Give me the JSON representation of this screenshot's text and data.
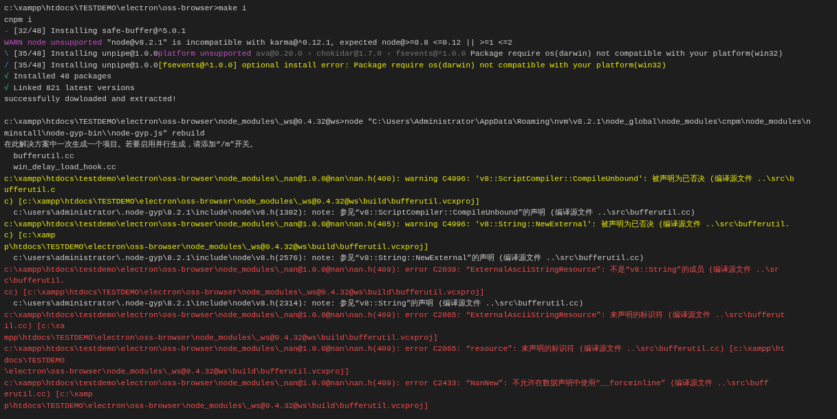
{
  "terminal": {
    "lines": [
      {
        "kind": "text",
        "segments": [
          {
            "kind": "plain",
            "text": "c:\\xampp\\htdocs\\TESTDEMO\\electron\\oss-browser>make i"
          }
        ]
      },
      {
        "kind": "text",
        "segments": [
          {
            "kind": "plain",
            "text": "cnpm i"
          }
        ]
      },
      {
        "kind": "text",
        "segments": [
          {
            "kind": "blue",
            "text": "- "
          },
          {
            "kind": "plain",
            "text": "[32/48] Installing safe-buffer@^5.0.1"
          }
        ]
      },
      {
        "kind": "text",
        "segments": [
          {
            "kind": "magenta",
            "text": "WARN node unsupported"
          },
          {
            "kind": "plain",
            "text": " \"node@v8.2.1\" is incompatible with karma@^0.12.1, expected node@>=0.8 <=0.12 || >=1 <=2"
          }
        ]
      },
      {
        "kind": "text",
        "segments": [
          {
            "kind": "blue",
            "text": "\\ "
          },
          {
            "kind": "plain",
            "text": "[35/48] Installing unpipe@1.0.0"
          },
          {
            "kind": "magenta",
            "text": "platform unsupported"
          },
          {
            "kind": "gray",
            "text": " ava@0.20.0 › chokidar@1.7.0 › fsevents@^1.0.0"
          },
          {
            "kind": "plain",
            "text": " Package require os(darwin) not compatible with your platform(win32)"
          }
        ]
      },
      {
        "kind": "text",
        "segments": [
          {
            "kind": "blue",
            "text": "/ "
          },
          {
            "kind": "plain",
            "text": "[35/48] Installing unpipe@1.0.0"
          },
          {
            "kind": "yellow",
            "text": "[fsevents@^1.0.0] optional install error: Package require os(darwin) not compatible with your platform(win32)"
          }
        ]
      },
      {
        "kind": "text",
        "segments": [
          {
            "kind": "green",
            "text": "√"
          },
          {
            "kind": "plain",
            "text": " Installed 48 packages"
          }
        ]
      },
      {
        "kind": "text",
        "segments": [
          {
            "kind": "green",
            "text": "√"
          },
          {
            "kind": "plain",
            "text": " Linked 821 latest versions"
          }
        ]
      },
      {
        "kind": "text",
        "segments": [
          {
            "kind": "plain",
            "text": "successfully dowloaded and extracted!"
          }
        ]
      },
      {
        "kind": "blank"
      },
      {
        "kind": "text",
        "segments": [
          {
            "kind": "plain",
            "text": "c:\\xampp\\htdocs\\TESTDEMO\\electron\\oss-browser\\node_modules\\_ws@0.4.32@ws>node \"C:\\Users\\Administrator\\AppData\\Roaming\\nvm\\v8.2.1\\node_global\\node_modules\\cnpm\\node_modules\\n"
          }
        ]
      },
      {
        "kind": "text",
        "segments": [
          {
            "kind": "plain",
            "text": "minstall\\node-gyp-bin\\\\node-gyp.js\" rebuild"
          }
        ]
      },
      {
        "kind": "text",
        "segments": [
          {
            "kind": "plain",
            "text": "在此解决方案中一次生成一个项目。若要启用并行生成，请添加“/m”开关。"
          }
        ]
      },
      {
        "kind": "text",
        "segments": [
          {
            "kind": "plain",
            "text": "  bufferutil.cc"
          }
        ]
      },
      {
        "kind": "text",
        "segments": [
          {
            "kind": "plain",
            "text": "  win_delay_load_hook.cc"
          }
        ]
      },
      {
        "kind": "text",
        "segments": [
          {
            "kind": "yellow",
            "text": "c:\\xampp\\htdocs\\testdemo\\electron\\oss-browser\\node_modules\\_nan@1.0.0@nan\\nan.h(400): warning C4996: 'v8::ScriptCompiler::CompileUnbound': 被声明为已否决 (编译源文件 ..\\src\\b"
          }
        ]
      },
      {
        "kind": "text",
        "segments": [
          {
            "kind": "yellow",
            "text": "ufferutil.c"
          }
        ]
      },
      {
        "kind": "text",
        "segments": [
          {
            "kind": "yellow",
            "text": "c) [c:\\xampp\\htdocs\\TESTDEMO\\electron\\oss-browser\\node_modules\\_ws@0.4.32@ws\\build\\bufferutil.vcxproj]"
          }
        ]
      },
      {
        "kind": "text",
        "segments": [
          {
            "kind": "plain",
            "text": "  c:\\users\\administrator\\.node-gyp\\8.2.1\\include\\node\\v8.h(1302): note: 参见“v8::ScriptCompiler::CompileUnbound”的声明 (编译源文件 ..\\src\\bufferutil.cc)"
          }
        ]
      },
      {
        "kind": "text",
        "segments": [
          {
            "kind": "yellow",
            "text": "c:\\xampp\\htdocs\\testdemo\\electron\\oss-browser\\node_modules\\_nan@1.0.0@nan\\nan.h(405): warning C4996: 'v8::String::NewExternal': 被声明为已否决 (编译源文件 ..\\src\\bufferutil."
          }
        ]
      },
      {
        "kind": "text",
        "segments": [
          {
            "kind": "yellow",
            "text": "c) [c:\\xamp"
          }
        ]
      },
      {
        "kind": "text",
        "segments": [
          {
            "kind": "yellow",
            "text": "p\\htdocs\\TESTDEMO\\electron\\oss-browser\\node_modules\\_ws@0.4.32@ws\\build\\bufferutil.vcxproj]"
          }
        ]
      },
      {
        "kind": "text",
        "segments": [
          {
            "kind": "plain",
            "text": "  c:\\users\\administrator\\.node-gyp\\8.2.1\\include\\node\\v8.h(2576): note: 参见“v8::String::NewExternal”的声明 (编译源文件 ..\\src\\bufferutil.cc)"
          }
        ]
      },
      {
        "kind": "text",
        "segments": [
          {
            "kind": "red",
            "text": "c:\\xampp\\htdocs\\testdemo\\electron\\oss-browser\\node_modules\\_nan@1.0.0@nan\\nan.h(409): error C2039: “ExternalAsciiStringResource”: 不是“v8::String”的成员 (编译源文件 ..\\sr"
          }
        ]
      },
      {
        "kind": "text",
        "segments": [
          {
            "kind": "red",
            "text": "c\\bufferutil."
          }
        ]
      },
      {
        "kind": "text",
        "segments": [
          {
            "kind": "red",
            "text": "cc) [c:\\xampp\\htdocs\\TESTDEMO\\electron\\oss-browser\\node_modules\\_ws@0.4.32@ws\\build\\bufferutil.vcxproj]"
          }
        ]
      },
      {
        "kind": "text",
        "segments": [
          {
            "kind": "plain",
            "text": "  c:\\users\\administrator\\.node-gyp\\8.2.1\\include\\node\\v8.h(2314): note: 参见“v8::String”的声明 (编译源文件 ..\\src\\bufferutil.cc)"
          }
        ]
      },
      {
        "kind": "text",
        "segments": [
          {
            "kind": "red",
            "text": "c:\\xampp\\htdocs\\testdemo\\electron\\oss-browser\\node_modules\\_nan@1.0.0@nan\\nan.h(409): error C2065: “ExternalAsciiStringResource”: 未声明的标识符 (编译源文件 ..\\src\\bufferut"
          }
        ]
      },
      {
        "kind": "text",
        "segments": [
          {
            "kind": "red",
            "text": "il.cc) [c:\\xa"
          }
        ]
      },
      {
        "kind": "text",
        "segments": [
          {
            "kind": "red",
            "text": "mpp\\htdocs\\TESTDEMO\\electron\\oss-browser\\node_modules\\_ws@0.4.32@ws\\build\\bufferutil.vcxproj]"
          }
        ]
      },
      {
        "kind": "text",
        "segments": [
          {
            "kind": "red",
            "text": "c:\\xampp\\htdocs\\testdemo\\electron\\oss-browser\\node_modules\\_nan@1.0.0@nan\\nan.h(409): error C2065: “resource”: 未声明的标识符 (编译源文件 ..\\src\\bufferutil.cc) [c:\\xampp\\ht"
          }
        ]
      },
      {
        "kind": "text",
        "segments": [
          {
            "kind": "red",
            "text": "docs\\TESTDEMO"
          }
        ]
      },
      {
        "kind": "text",
        "segments": [
          {
            "kind": "red",
            "text": "\\electron\\oss-browser\\node_modules\\_ws@0.4.32@ws\\build\\bufferutil.vcxproj]"
          }
        ]
      },
      {
        "kind": "text",
        "segments": [
          {
            "kind": "red",
            "text": "c:\\xampp\\htdocs\\testdemo\\electron\\oss-browser\\node_modules\\_nan@1.0.0@nan\\nan.h(409): error C2433: “NanNew”: 不允许在数据声明中使用“__forceinline” (编译源文件 ..\\src\\buff"
          }
        ]
      },
      {
        "kind": "text",
        "segments": [
          {
            "kind": "red",
            "text": "erutil.cc) [c:\\xamp"
          }
        ]
      },
      {
        "kind": "text",
        "segments": [
          {
            "kind": "red",
            "text": "p\\htdocs\\TESTDEMO\\electron\\oss-browser\\node_modules\\_ws@0.4.32@ws\\build\\bufferutil.vcxproj]"
          }
        ]
      }
    ]
  }
}
